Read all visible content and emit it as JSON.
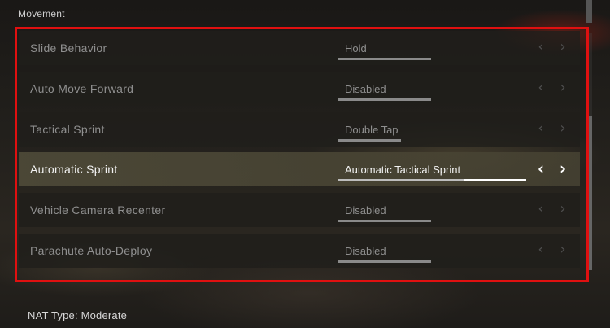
{
  "section": {
    "title": "Movement"
  },
  "settings": [
    {
      "label": "Slide Behavior",
      "value": "Hold",
      "selected": false
    },
    {
      "label": "Auto Move Forward",
      "value": "Disabled",
      "selected": false
    },
    {
      "label": "Tactical Sprint",
      "value": "Double Tap",
      "selected": false
    },
    {
      "label": "Automatic Sprint",
      "value": "Automatic Tactical Sprint",
      "selected": true
    },
    {
      "label": "Vehicle Camera Recenter",
      "value": "Disabled",
      "selected": false
    },
    {
      "label": "Parachute Auto-Deploy",
      "value": "Disabled",
      "selected": false
    }
  ],
  "arrows": {
    "left": "‹",
    "right": "›"
  },
  "footer": {
    "nat_type": "NAT Type: Moderate"
  },
  "colors": {
    "highlight_frame": "#e01010",
    "selected_row": "#4e4a38"
  },
  "icons": {
    "prev": "chevron-left-icon",
    "next": "chevron-right-icon"
  }
}
